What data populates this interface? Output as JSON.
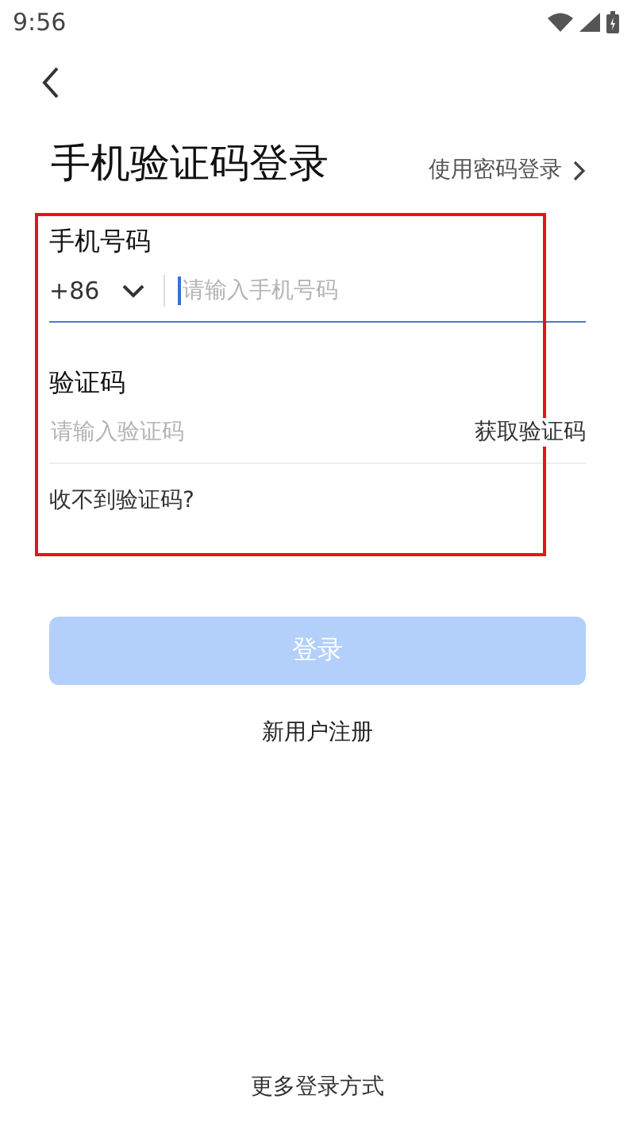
{
  "status_bar": {
    "time": "9:56"
  },
  "header": {
    "title": "手机验证码登录",
    "switch_link": "使用密码登录"
  },
  "phone": {
    "label": "手机号码",
    "country_code": "+86",
    "placeholder": "请输入手机号码",
    "focused": true
  },
  "code": {
    "label": "验证码",
    "placeholder": "请输入验证码",
    "get_code": "获取验证码"
  },
  "help_link": "收不到验证码?",
  "login_button": {
    "label": "登录",
    "disabled": true
  },
  "register_link": "新用户注册",
  "more_options": "更多登录方式"
}
